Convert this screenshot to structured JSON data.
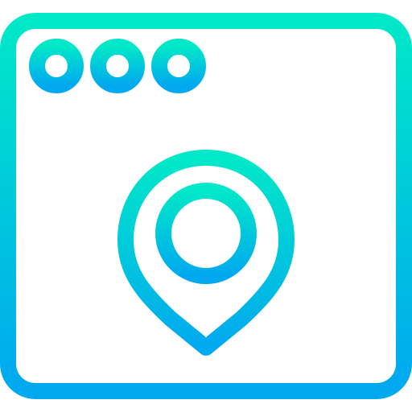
{
  "icon": {
    "name": "browser-location-pin-icon",
    "window_dots": [
      "dot-1",
      "dot-2",
      "dot-3"
    ],
    "colors": {
      "gradient_top": "#00e8c8",
      "gradient_bottom": "#00a8f0",
      "background": "#ffffff"
    }
  }
}
